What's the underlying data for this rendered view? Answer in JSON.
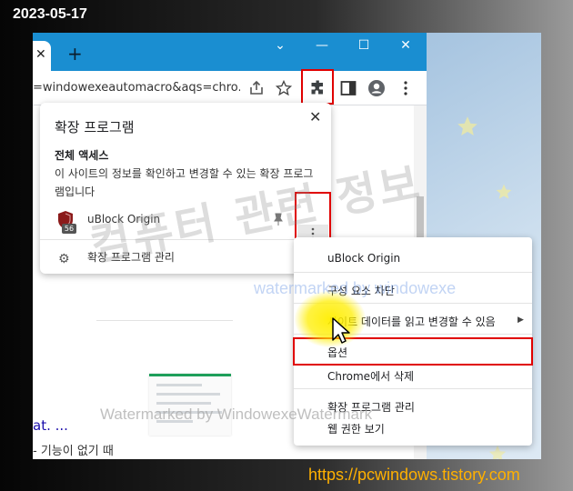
{
  "date_stamp": "2023-05-17",
  "browser": {
    "tab": {
      "close_glyph": "✕"
    },
    "new_tab_glyph": "+",
    "window_controls": {
      "tab_search": "⌄",
      "minimize": "—",
      "maximize": "☐",
      "close": "✕"
    },
    "toolbar": {
      "url_text": "=windowexeautomacro&aqs=chro...",
      "icons": [
        "share-icon",
        "bookmark-star-icon",
        "extensions-puzzle-icon",
        "side-panel-icon",
        "profile-icon",
        "menu-kebab-icon"
      ]
    },
    "page": {
      "link_text": "at. ...",
      "body_text": "- 기능이 없기 때"
    }
  },
  "extensions_popup": {
    "title": "확장 프로그램",
    "close_glyph": "✕",
    "access_heading": "전체 액세스",
    "access_description": "이 사이트의 정보를 확인하고 변경할 수 있는 확장 프로그램입니다",
    "extension": {
      "name": "uBlock Origin",
      "badge_count": "56",
      "icon": "ublock-shield-icon",
      "pin_icon": "pin-icon",
      "more_icon": "more-vertical-icon"
    },
    "manage_label": "확장 프로그램 관리",
    "manage_icon": "gear-icon"
  },
  "context_menu": {
    "header": "uBlock Origin",
    "block_element": "구성 요소 차단",
    "site_data": "사이트 데이터를 읽고 변경할 수 있음",
    "submenu_arrow": "▶",
    "options": "옵션",
    "remove": "Chrome에서 삭제",
    "manage": "확장 프로그램 관리",
    "view_permissions": "웹 권한 보기"
  },
  "watermarks": {
    "korean": "컴퓨터 관련 정보",
    "blue": "watermarked by windowexe",
    "bottom": "Watermarked by WindowexeWatermark"
  },
  "site_url": "https://pcwindows.tistory.com",
  "colors": {
    "tab_bar": "#1a8ed1",
    "highlight_red": "#e00000",
    "site_url": "#ffb000",
    "cursor_glow": "#ffee00"
  }
}
